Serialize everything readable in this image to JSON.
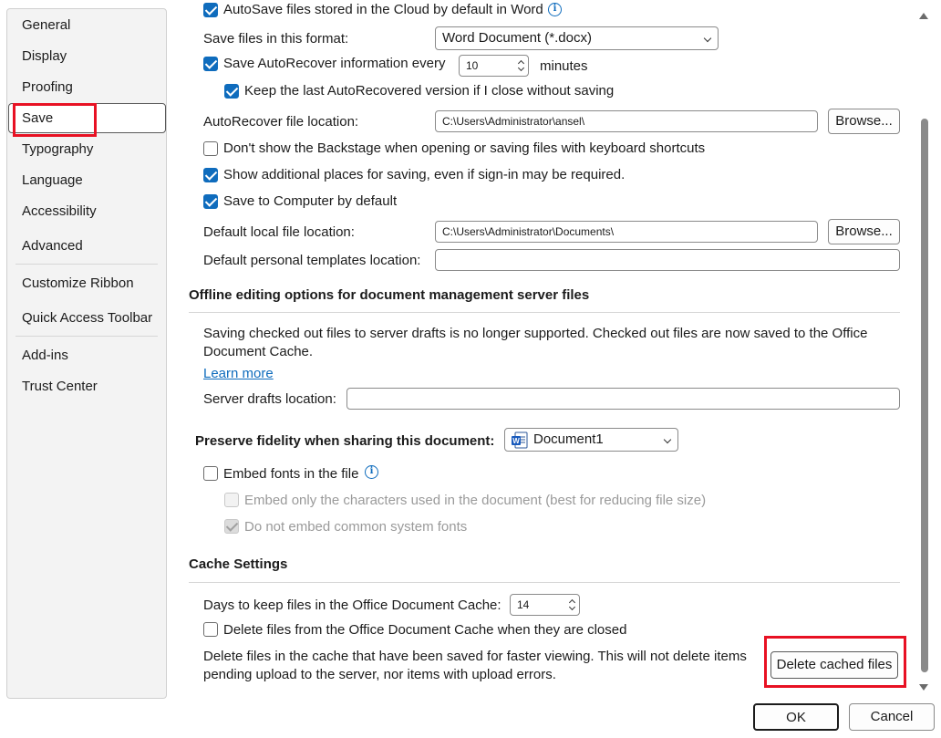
{
  "nav": {
    "items": [
      {
        "label": "General"
      },
      {
        "label": "Display"
      },
      {
        "label": "Proofing"
      },
      {
        "label": "Save"
      },
      {
        "label": "Typography"
      },
      {
        "label": "Language"
      },
      {
        "label": "Accessibility"
      },
      {
        "label": "Advanced"
      },
      {
        "label": "Customize Ribbon"
      },
      {
        "label": "Quick Access Toolbar"
      },
      {
        "label": "Add-ins"
      },
      {
        "label": "Trust Center"
      }
    ],
    "selected": "Save"
  },
  "save": {
    "autosave_label": "AutoSave files stored in the Cloud by default in Word",
    "format_label": "Save files in this format:",
    "format_value": "Word Document (*.docx)",
    "autorecover_label": "Save AutoRecover information every",
    "autorecover_minutes": "10",
    "minutes_label": "minutes",
    "keep_last_label": "Keep the last AutoRecovered version if I close without saving",
    "autorecover_location_label": "AutoRecover file location:",
    "autorecover_location_value": "C:\\Users\\Administrator\\ansel\\",
    "browse_label": "Browse...",
    "backstage_label": "Don't show the Backstage when opening or saving files with keyboard shortcuts",
    "additional_places_label": "Show additional places for saving, even if sign-in may be required.",
    "save_computer_label": "Save to Computer by default",
    "default_local_label": "Default local file location:",
    "default_local_value": "C:\\Users\\Administrator\\Documents\\",
    "templates_label": "Default personal templates location:",
    "templates_value": ""
  },
  "offline": {
    "header": "Offline editing options for document management server files",
    "desc_line1": "Saving checked out files to server drafts is no longer supported. Checked out files are now saved to the Office",
    "desc_line2": "Document Cache.",
    "learn_more": "Learn more",
    "server_drafts_label": "Server drafts location:",
    "server_drafts_value": ""
  },
  "fidelity": {
    "header": "Preserve fidelity when sharing this document:",
    "document_value": "Document1",
    "embed_fonts_label": "Embed fonts in the file",
    "embed_chars_label": "Embed only the characters used in the document (best for reducing file size)",
    "no_common_label": "Do not embed common system fonts"
  },
  "cache": {
    "header": "Cache Settings",
    "days_label": "Days to keep files in the Office Document Cache:",
    "days_value": "14",
    "delete_closed_label": "Delete files from the Office Document Cache when they are closed",
    "delete_desc_line1": "Delete files in the cache that have been saved for faster viewing. This will not delete items",
    "delete_desc_line2": "pending upload to the server, nor items with upload errors.",
    "delete_button": "Delete cached files"
  },
  "footer": {
    "ok": "OK",
    "cancel": "Cancel"
  },
  "colors": {
    "accent": "#0f6cbd",
    "highlight": "#e81123"
  }
}
